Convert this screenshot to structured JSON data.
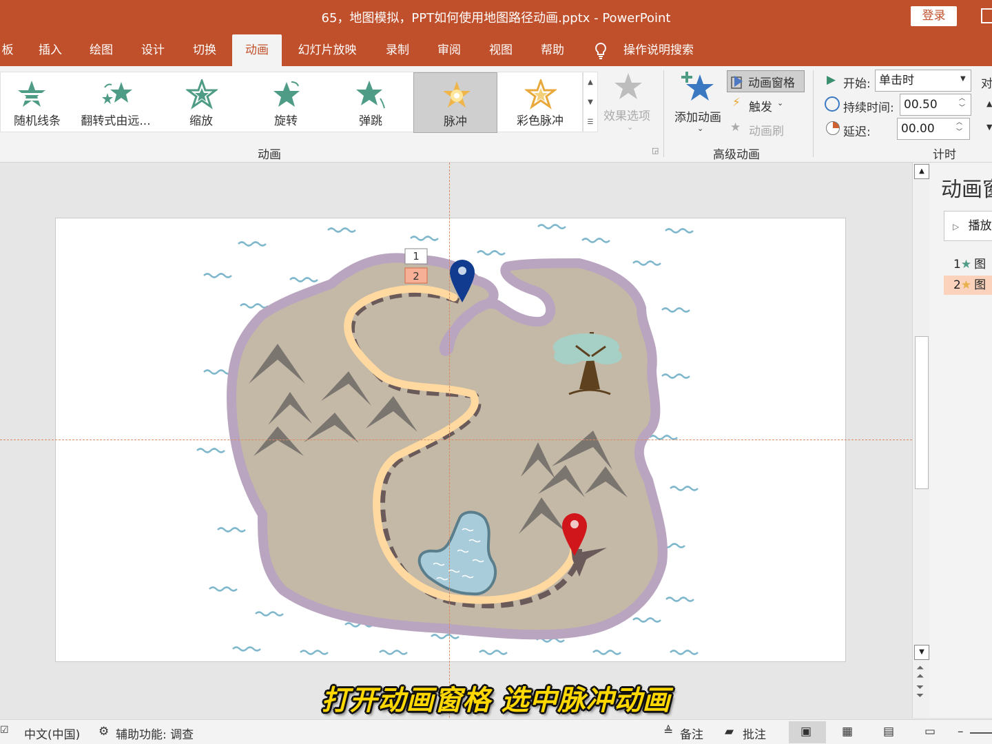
{
  "window": {
    "title": "65，地图模拟，PPT如何使用地图路径动画.pptx  -  PowerPoint",
    "login": "登录"
  },
  "tabs": [
    {
      "label": "板"
    },
    {
      "label": "插入"
    },
    {
      "label": "绘图"
    },
    {
      "label": "设计"
    },
    {
      "label": "切换"
    },
    {
      "label": "动画",
      "active": true
    },
    {
      "label": "幻灯片放映"
    },
    {
      "label": "录制"
    },
    {
      "label": "审阅"
    },
    {
      "label": "视图"
    },
    {
      "label": "帮助"
    },
    {
      "label": "操作说明搜索"
    }
  ],
  "ribbon": {
    "animations": [
      {
        "label": "随机线条",
        "icon": "random-bars-star-icon"
      },
      {
        "label": "翻转式由远...",
        "icon": "grow-turn-star-icon"
      },
      {
        "label": "缩放",
        "icon": "zoom-star-icon"
      },
      {
        "label": "旋转",
        "icon": "swivel-star-icon"
      },
      {
        "label": "弹跳",
        "icon": "bounce-star-icon"
      },
      {
        "label": "脉冲",
        "icon": "pulse-icon",
        "selected": true
      },
      {
        "label": "彩色脉冲",
        "icon": "color-pulse-icon"
      }
    ],
    "effect_options": "效果选项",
    "group_animation": "动画",
    "add_animation": "添加动画",
    "animation_pane": "动画窗格",
    "trigger": "触发",
    "painter": "动画刷",
    "group_advanced": "高级动画",
    "start_label": "开始:",
    "start_value": "单击时",
    "duration_label": "持续时间:",
    "duration_value": "00.50",
    "delay_label": "延迟:",
    "delay_value": "00.00",
    "group_timing": "计时",
    "reorder_cut": "对"
  },
  "slide": {
    "tag1": "1",
    "tag2": "2"
  },
  "pane": {
    "title": "动画窗",
    "play": "播放",
    "items": [
      {
        "num": "1",
        "label": "图",
        "selected": false
      },
      {
        "num": "2",
        "label": "图",
        "selected": true
      }
    ]
  },
  "caption": "打开动画窗格  选中脉冲动画",
  "status": {
    "lang": "中文(中国)",
    "accessibility": "辅助功能: 调查",
    "notes": "备注",
    "comments": "批注"
  },
  "colors": {
    "accent": "#c0502b",
    "island": "#c4b9a6",
    "shore": "#b9a5c0",
    "path": "#ffd9a0",
    "pin_start": "#103b8f",
    "pin_end": "#d0161a",
    "water": "#7fb8cc"
  }
}
